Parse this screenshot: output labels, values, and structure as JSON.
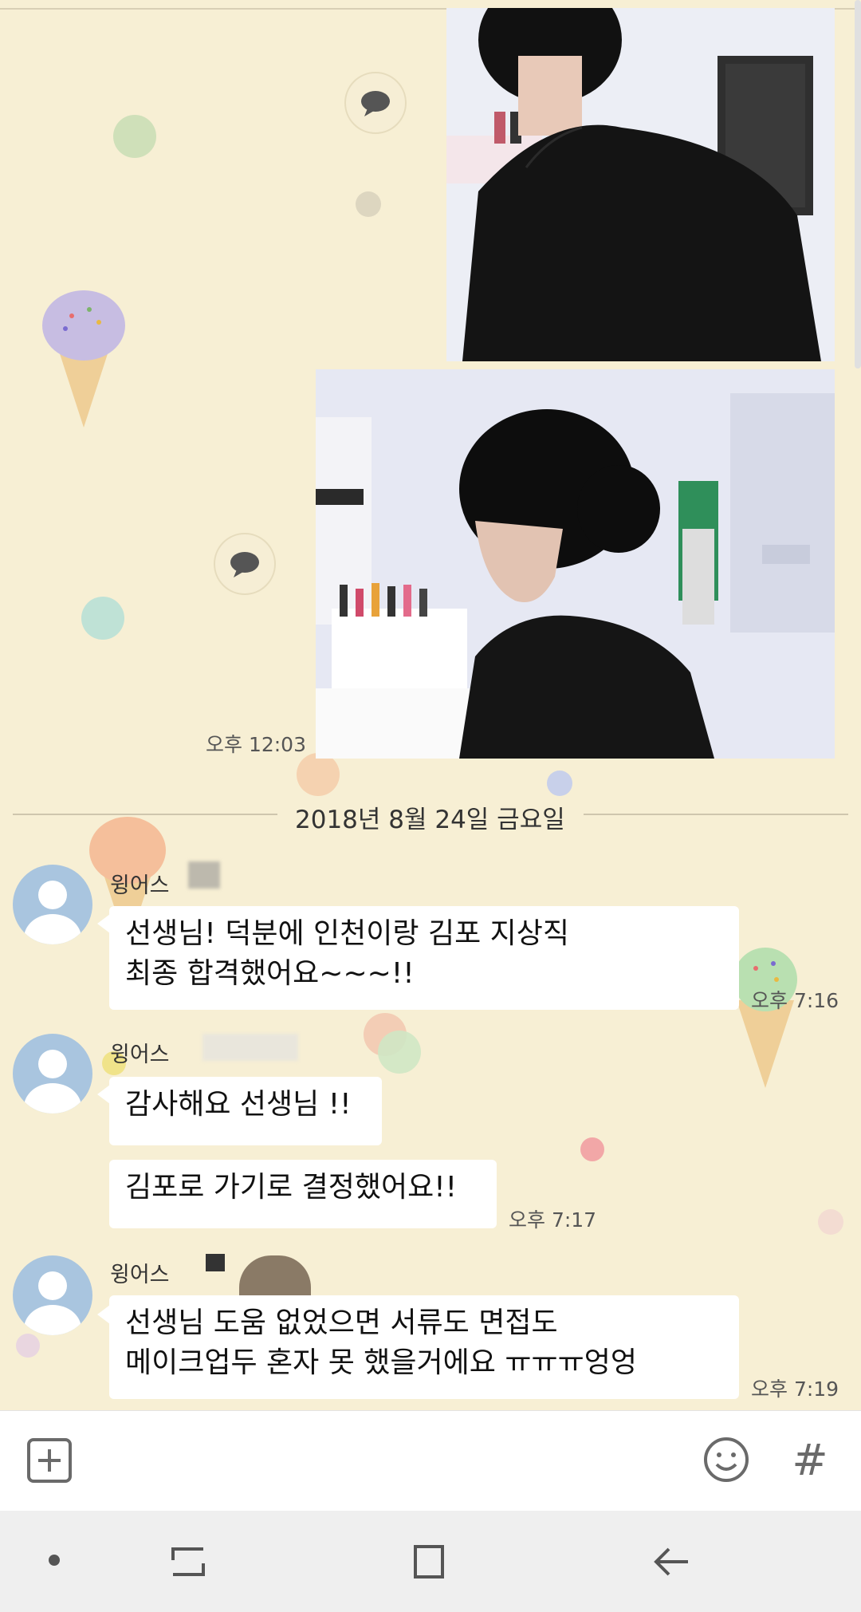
{
  "messages": {
    "time_1": "오후 12:03",
    "date_divider": "2018년 8월 24일 금요일",
    "group1": {
      "sender": "윙어스",
      "text_line1": "선생님! 덕분에 인천이랑 김포 지상직",
      "text_line2": "최종 합격했어요~~~!!",
      "time": "오후 7:16"
    },
    "group2": {
      "sender": "윙어스",
      "text_a": "감사해요 선생님 !!",
      "text_b": "김포로 가기로 결정했어요!!",
      "time": "오후 7:17"
    },
    "group3": {
      "sender": "윙어스",
      "text_line1": "선생님 도움 없었으면 서류도 면접도",
      "text_line2": "메이크업두 혼자 못 했을거에요 ㅠㅠㅠ엉엉",
      "time": "오후 7:19"
    }
  },
  "input_bar": {
    "attach_icon": "plus-square-icon",
    "emoji_icon": "smiley-icon",
    "hash_label": "#"
  },
  "nav_bar": {
    "icons": [
      "dot-icon",
      "recent-apps-icon",
      "home-icon",
      "back-icon"
    ]
  },
  "colors": {
    "background": "#f7efd4",
    "bubble": "#ffffff",
    "avatar": "#a9c5df"
  }
}
